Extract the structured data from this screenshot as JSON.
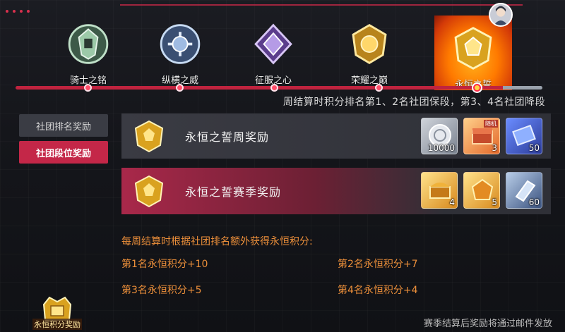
{
  "tiers": [
    {
      "name": "骑士之铭",
      "badge_color": "#8fbf9a",
      "icon": "knight-badge-icon"
    },
    {
      "name": "纵横之威",
      "badge_color": "#8fb0d8",
      "icon": "valor-badge-icon"
    },
    {
      "name": "征服之心",
      "badge_color": "#a88ad8",
      "icon": "conquest-badge-icon"
    },
    {
      "name": "荣耀之巅",
      "badge_color": "#e0b84a",
      "icon": "glory-badge-icon"
    },
    {
      "name": "永恒之誓",
      "badge_color": "#ffd243",
      "icon": "eternal-badge-icon"
    }
  ],
  "rule_text": "周结算时积分排名第1、2名社团保段，第3、4名社团降段",
  "tabs": {
    "rank_rewards": "社团排名奖励",
    "tier_rewards": "社团段位奖励"
  },
  "rewards": {
    "weekly": {
      "title": "永恒之誓周奖励",
      "items": [
        {
          "icon": "silver-coin-icon",
          "qty": "10000",
          "style": "silver"
        },
        {
          "icon": "random-chest-icon",
          "qty": "3",
          "tag": "随机",
          "style": "orange"
        },
        {
          "icon": "blue-ticket-icon",
          "qty": "50",
          "style": "blue"
        }
      ]
    },
    "season": {
      "title": "永恒之誓赛季奖励",
      "items": [
        {
          "icon": "gold-chest-icon",
          "qty": "4",
          "style": "gold"
        },
        {
          "icon": "gem-box-icon",
          "qty": "5",
          "style": "gold"
        },
        {
          "icon": "crystal-shard-icon",
          "qty": "60",
          "style": "ice"
        }
      ]
    }
  },
  "info": {
    "head": "每周结算时根据社团排名额外获得永恒积分:",
    "rank1": "第1名永恒积分+10",
    "rank2": "第2名永恒积分+7",
    "rank3": "第3名永恒积分+5",
    "rank4": "第4名永恒积分+4"
  },
  "points_award_label": "永恒积分奖励",
  "footer_note": "赛季结算后奖励将通过邮件发放",
  "colors": {
    "accent": "#c42748",
    "info_orange": "#ec8f3a"
  }
}
